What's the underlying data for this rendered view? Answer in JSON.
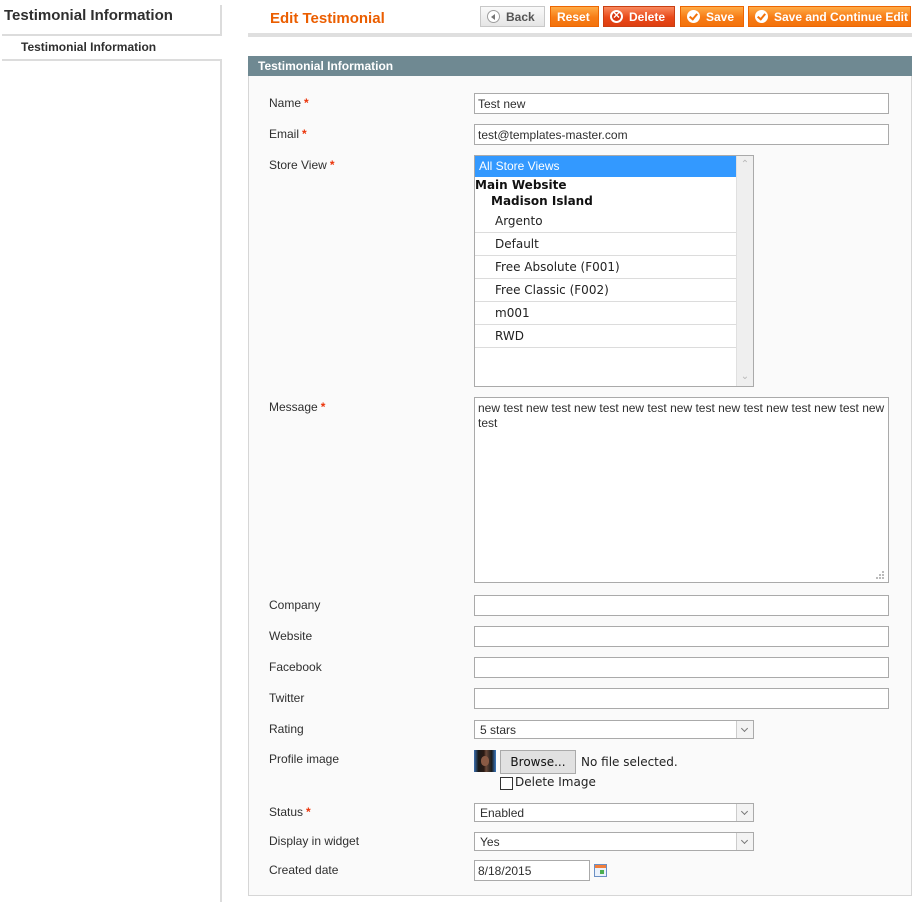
{
  "sidebar": {
    "title": "Testimonial Information",
    "items": [
      {
        "label": "Testimonial Information",
        "active": true
      }
    ]
  },
  "header": {
    "title": "Edit Testimonial",
    "buttons": {
      "back": "Back",
      "reset": "Reset",
      "delete": "Delete",
      "save": "Save",
      "save_continue": "Save and Continue Edit"
    }
  },
  "fieldset": {
    "legend": "Testimonial Information",
    "required_marker": "*",
    "fields": {
      "name": {
        "label": "Name",
        "value": "Test new",
        "required": true
      },
      "email": {
        "label": "Email",
        "value": "test@templates-master.com",
        "required": true
      },
      "store_view": {
        "label": "Store View",
        "required": true,
        "selected": "All Store Views",
        "groups": {
          "website": "Main Website",
          "store": "Madison Island"
        },
        "options": [
          "Argento",
          "Default",
          "Free Absolute (F001)",
          "Free Classic (F002)",
          "m001",
          "RWD"
        ]
      },
      "message": {
        "label": "Message",
        "value": "new test new test new test new test new test new test new test new test new test",
        "required": true
      },
      "company": {
        "label": "Company",
        "value": ""
      },
      "website": {
        "label": "Website",
        "value": ""
      },
      "facebook": {
        "label": "Facebook",
        "value": ""
      },
      "twitter": {
        "label": "Twitter",
        "value": ""
      },
      "rating": {
        "label": "Rating",
        "value": "5 stars"
      },
      "profile_image": {
        "label": "Profile image",
        "browse_label": "Browse...",
        "file_status": "No file selected.",
        "delete_label": "Delete Image",
        "delete_checked": false
      },
      "status": {
        "label": "Status",
        "value": "Enabled",
        "required": true
      },
      "display_in_widget": {
        "label": "Display in widget",
        "value": "Yes"
      },
      "created_date": {
        "label": "Created date",
        "value": "8/18/2015"
      }
    }
  },
  "colors": {
    "title_orange": "#eb5e00",
    "button_orange": "#f77c16",
    "delete_red": "#e9491a",
    "fieldset_header": "#6f8992",
    "selection_blue": "#3399ff",
    "required_red": "#eb340a"
  }
}
